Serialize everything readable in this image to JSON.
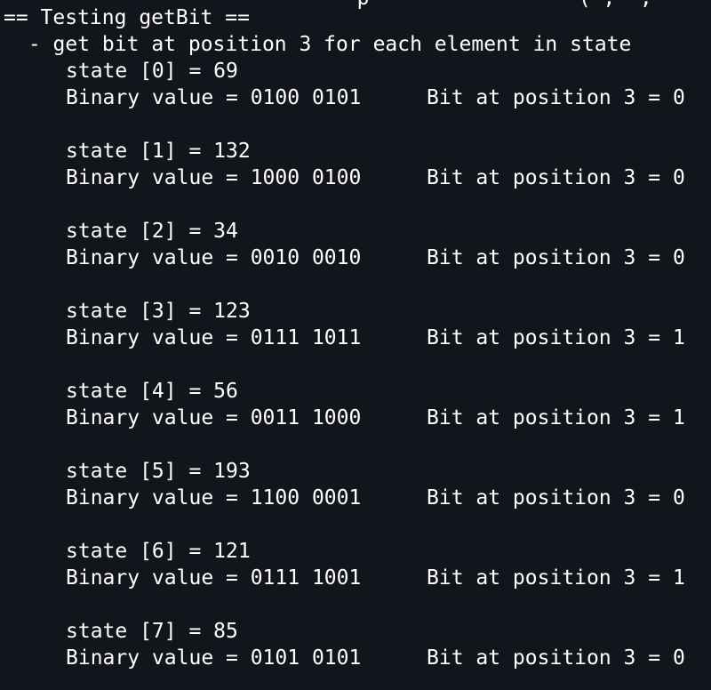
{
  "terminal": {
    "partial_top_line": "                             p                 ( ,  ,",
    "title": "== Testing getBit ==",
    "subtitle": " - get bit at position 3 for each element in state",
    "entries": [
      {
        "state": "state [0] = 69",
        "binary": "Binary value = 0100 0101",
        "bit": "Bit at position 3 = 0"
      },
      {
        "state": "state [1] = 132",
        "binary": "Binary value = 1000 0100",
        "bit": "Bit at position 3 = 0"
      },
      {
        "state": "state [2] = 34",
        "binary": "Binary value = 0010 0010",
        "bit": "Bit at position 3 = 0"
      },
      {
        "state": "state [3] = 123",
        "binary": "Binary value = 0111 1011",
        "bit": "Bit at position 3 = 1"
      },
      {
        "state": "state [4] = 56",
        "binary": "Binary value = 0011 1000",
        "bit": "Bit at position 3 = 1"
      },
      {
        "state": "state [5] = 193",
        "binary": "Binary value = 1100 0001",
        "bit": "Bit at position 3 = 0"
      },
      {
        "state": "state [6] = 121",
        "binary": "Binary value = 0111 1001",
        "bit": "Bit at position 3 = 1"
      },
      {
        "state": "state [7] = 85",
        "binary": "Binary value = 0101 0101",
        "bit": "Bit at position 3 = 0"
      }
    ]
  },
  "colors": {
    "background": "#13151c",
    "foreground": "#ffffff"
  }
}
